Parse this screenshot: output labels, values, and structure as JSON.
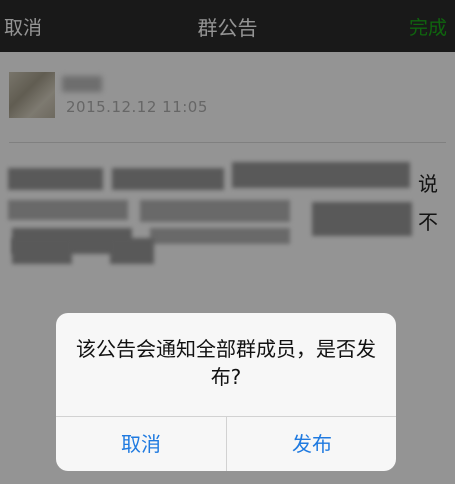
{
  "navbar": {
    "cancel_label": "取消",
    "title": "群公告",
    "done_label": "完成"
  },
  "post": {
    "timestamp": "2015.12.12  11:05",
    "visible_chars": [
      "说",
      "不"
    ]
  },
  "dialog": {
    "message": "该公告会通知全部群成员，是否发布?",
    "cancel_label": "取消",
    "publish_label": "发布"
  },
  "colors": {
    "navbar_bg": "#2b2b2b",
    "done_accent": "#1aad19",
    "dialog_button": "#1f7ae0"
  }
}
